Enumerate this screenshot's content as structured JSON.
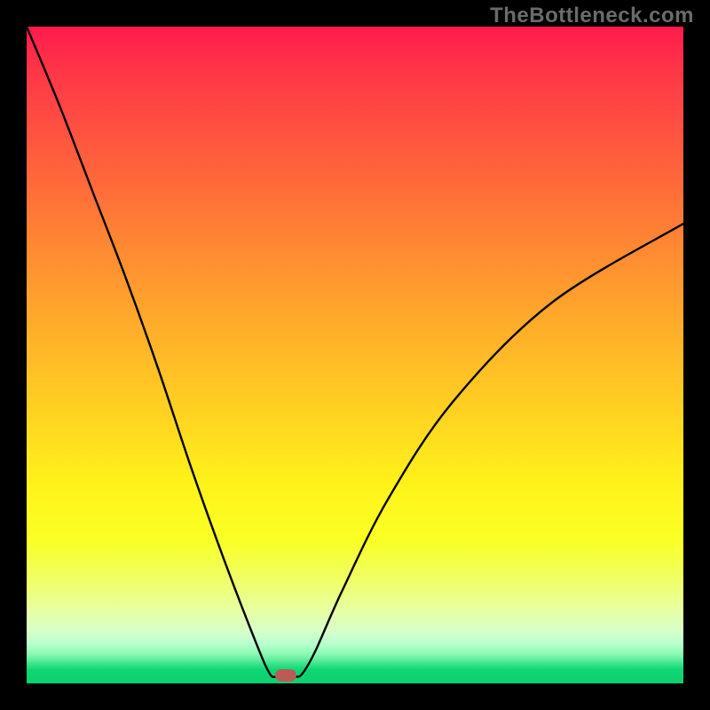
{
  "watermark": "TheBottleneck.com",
  "chart_data": {
    "type": "line",
    "title": "",
    "xlabel": "",
    "ylabel": "",
    "xlim": [
      0,
      100
    ],
    "ylim": [
      0,
      100
    ],
    "series": [
      {
        "name": "bottleneck-curve",
        "x": [
          0,
          5,
          10,
          15,
          20,
          25,
          30,
          35,
          37,
          38,
          39,
          40,
          41,
          42,
          44,
          48,
          55,
          65,
          80,
          100
        ],
        "values": [
          100,
          88,
          75,
          62,
          48,
          33,
          19,
          6,
          1.5,
          1,
          1,
          1,
          1,
          1.5,
          5,
          14,
          28,
          43,
          58,
          70
        ]
      }
    ],
    "marker": {
      "x": 39.5,
      "y": 1.2,
      "color": "#bb5b56"
    },
    "background_gradient": {
      "top": "#ff1a4d",
      "mid": "#ffd022",
      "bottom": "#09d26f"
    }
  }
}
